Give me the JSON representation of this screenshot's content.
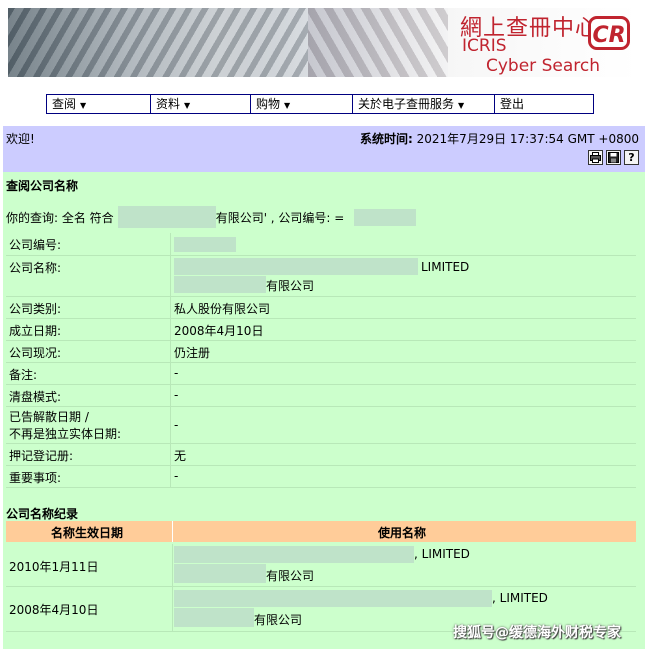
{
  "banner": {
    "title_cn": "網上查冊中心",
    "title_icris": "ICRIS",
    "title_cyber": "Cyber Search Centre",
    "logo": "CR",
    "accent_color": "#c0242f"
  },
  "menu": {
    "items": [
      {
        "label": "查阅",
        "has_dropdown": true
      },
      {
        "label": "资料",
        "has_dropdown": true
      },
      {
        "label": "购物",
        "has_dropdown": true
      },
      {
        "label": "关於电子查冊服务",
        "has_dropdown": true
      },
      {
        "label": "登出",
        "has_dropdown": false
      }
    ]
  },
  "welcome": {
    "greeting": "欢迎!",
    "time_label": "系统时间:",
    "time_value": "2021年7月29日 17:37:54 GMT +0800",
    "icons": [
      "printer-icon",
      "save-icon",
      "help-icon"
    ]
  },
  "search": {
    "section_title": "查阅公司名称",
    "query_prefix": "你的查询:  全名 符合",
    "query_suffix": "有限公司' , 公司编号:  ="
  },
  "company": {
    "rows": [
      {
        "label": "公司编号:",
        "value": ""
      },
      {
        "label": "公司名称:",
        "value_line1": "LIMITED",
        "value_line2": "有限公司"
      },
      {
        "label": "公司类别:",
        "value": "私人股份有限公司"
      },
      {
        "label": "成立日期:",
        "value": "2008年4月10日"
      },
      {
        "label": "公司现况:",
        "value": "仍注册"
      },
      {
        "label": "备注:",
        "value": "-"
      },
      {
        "label": "清盘模式:",
        "value": "-"
      },
      {
        "label_line1": "已告解散日期 /",
        "label_line2": "不再是独立实体日期:",
        "value": "-"
      },
      {
        "label": "押记登记册:",
        "value": "无"
      },
      {
        "label": "重要事项:",
        "value": "-"
      }
    ]
  },
  "history": {
    "section_title": "公司名称纪录",
    "col_date": "名称生效日期",
    "col_name": "使用名称",
    "rows": [
      {
        "date": "2010年1月11日",
        "name_line1": ", LIMITED",
        "name_line2": "有限公司"
      },
      {
        "date": "2008年4月10日",
        "name_line1": ", LIMITED",
        "name_line2": "有限公司"
      }
    ]
  },
  "watermark": "搜狐号@缓德海外财税专家",
  "colors": {
    "welcome_bg": "#ccccff",
    "main_bg": "#ccffcc",
    "header_bg": "#ffcc99",
    "menu_border": "#000080"
  }
}
